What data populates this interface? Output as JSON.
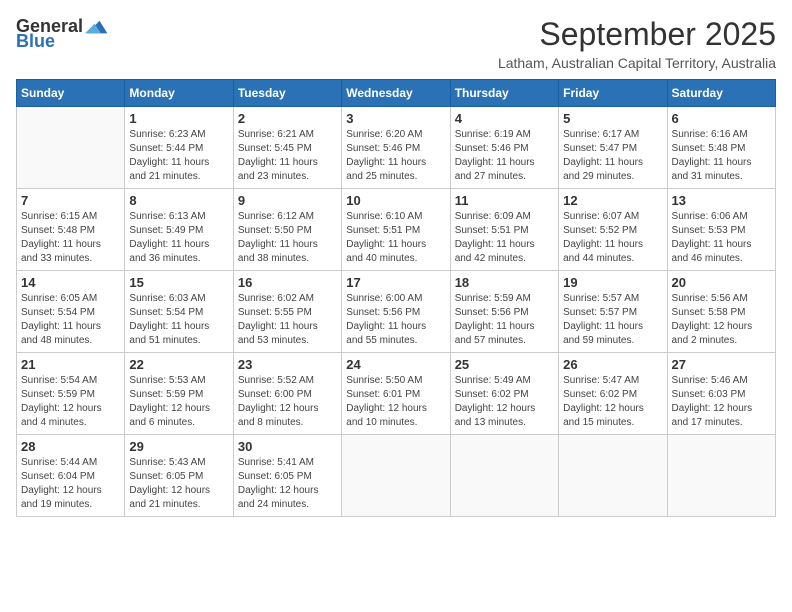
{
  "logo": {
    "general": "General",
    "blue": "Blue"
  },
  "title": "September 2025",
  "location": "Latham, Australian Capital Territory, Australia",
  "weekdays": [
    "Sunday",
    "Monday",
    "Tuesday",
    "Wednesday",
    "Thursday",
    "Friday",
    "Saturday"
  ],
  "weeks": [
    [
      {
        "day": "",
        "info": ""
      },
      {
        "day": "1",
        "info": "Sunrise: 6:23 AM\nSunset: 5:44 PM\nDaylight: 11 hours\nand 21 minutes."
      },
      {
        "day": "2",
        "info": "Sunrise: 6:21 AM\nSunset: 5:45 PM\nDaylight: 11 hours\nand 23 minutes."
      },
      {
        "day": "3",
        "info": "Sunrise: 6:20 AM\nSunset: 5:46 PM\nDaylight: 11 hours\nand 25 minutes."
      },
      {
        "day": "4",
        "info": "Sunrise: 6:19 AM\nSunset: 5:46 PM\nDaylight: 11 hours\nand 27 minutes."
      },
      {
        "day": "5",
        "info": "Sunrise: 6:17 AM\nSunset: 5:47 PM\nDaylight: 11 hours\nand 29 minutes."
      },
      {
        "day": "6",
        "info": "Sunrise: 6:16 AM\nSunset: 5:48 PM\nDaylight: 11 hours\nand 31 minutes."
      }
    ],
    [
      {
        "day": "7",
        "info": "Sunrise: 6:15 AM\nSunset: 5:48 PM\nDaylight: 11 hours\nand 33 minutes."
      },
      {
        "day": "8",
        "info": "Sunrise: 6:13 AM\nSunset: 5:49 PM\nDaylight: 11 hours\nand 36 minutes."
      },
      {
        "day": "9",
        "info": "Sunrise: 6:12 AM\nSunset: 5:50 PM\nDaylight: 11 hours\nand 38 minutes."
      },
      {
        "day": "10",
        "info": "Sunrise: 6:10 AM\nSunset: 5:51 PM\nDaylight: 11 hours\nand 40 minutes."
      },
      {
        "day": "11",
        "info": "Sunrise: 6:09 AM\nSunset: 5:51 PM\nDaylight: 11 hours\nand 42 minutes."
      },
      {
        "day": "12",
        "info": "Sunrise: 6:07 AM\nSunset: 5:52 PM\nDaylight: 11 hours\nand 44 minutes."
      },
      {
        "day": "13",
        "info": "Sunrise: 6:06 AM\nSunset: 5:53 PM\nDaylight: 11 hours\nand 46 minutes."
      }
    ],
    [
      {
        "day": "14",
        "info": "Sunrise: 6:05 AM\nSunset: 5:54 PM\nDaylight: 11 hours\nand 48 minutes."
      },
      {
        "day": "15",
        "info": "Sunrise: 6:03 AM\nSunset: 5:54 PM\nDaylight: 11 hours\nand 51 minutes."
      },
      {
        "day": "16",
        "info": "Sunrise: 6:02 AM\nSunset: 5:55 PM\nDaylight: 11 hours\nand 53 minutes."
      },
      {
        "day": "17",
        "info": "Sunrise: 6:00 AM\nSunset: 5:56 PM\nDaylight: 11 hours\nand 55 minutes."
      },
      {
        "day": "18",
        "info": "Sunrise: 5:59 AM\nSunset: 5:56 PM\nDaylight: 11 hours\nand 57 minutes."
      },
      {
        "day": "19",
        "info": "Sunrise: 5:57 AM\nSunset: 5:57 PM\nDaylight: 11 hours\nand 59 minutes."
      },
      {
        "day": "20",
        "info": "Sunrise: 5:56 AM\nSunset: 5:58 PM\nDaylight: 12 hours\nand 2 minutes."
      }
    ],
    [
      {
        "day": "21",
        "info": "Sunrise: 5:54 AM\nSunset: 5:59 PM\nDaylight: 12 hours\nand 4 minutes."
      },
      {
        "day": "22",
        "info": "Sunrise: 5:53 AM\nSunset: 5:59 PM\nDaylight: 12 hours\nand 6 minutes."
      },
      {
        "day": "23",
        "info": "Sunrise: 5:52 AM\nSunset: 6:00 PM\nDaylight: 12 hours\nand 8 minutes."
      },
      {
        "day": "24",
        "info": "Sunrise: 5:50 AM\nSunset: 6:01 PM\nDaylight: 12 hours\nand 10 minutes."
      },
      {
        "day": "25",
        "info": "Sunrise: 5:49 AM\nSunset: 6:02 PM\nDaylight: 12 hours\nand 13 minutes."
      },
      {
        "day": "26",
        "info": "Sunrise: 5:47 AM\nSunset: 6:02 PM\nDaylight: 12 hours\nand 15 minutes."
      },
      {
        "day": "27",
        "info": "Sunrise: 5:46 AM\nSunset: 6:03 PM\nDaylight: 12 hours\nand 17 minutes."
      }
    ],
    [
      {
        "day": "28",
        "info": "Sunrise: 5:44 AM\nSunset: 6:04 PM\nDaylight: 12 hours\nand 19 minutes."
      },
      {
        "day": "29",
        "info": "Sunrise: 5:43 AM\nSunset: 6:05 PM\nDaylight: 12 hours\nand 21 minutes."
      },
      {
        "day": "30",
        "info": "Sunrise: 5:41 AM\nSunset: 6:05 PM\nDaylight: 12 hours\nand 24 minutes."
      },
      {
        "day": "",
        "info": ""
      },
      {
        "day": "",
        "info": ""
      },
      {
        "day": "",
        "info": ""
      },
      {
        "day": "",
        "info": ""
      }
    ]
  ]
}
